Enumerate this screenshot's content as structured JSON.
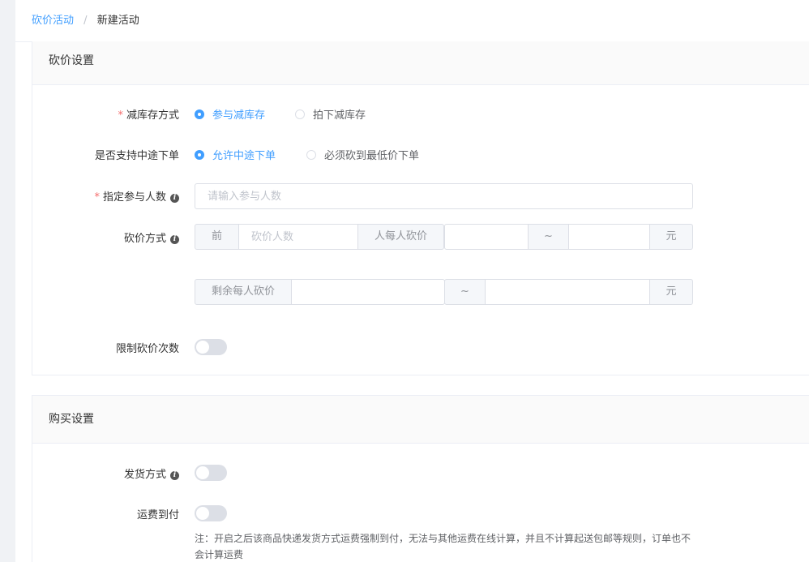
{
  "breadcrumb": {
    "parent": "砍价活动",
    "separator": "/",
    "current": "新建活动"
  },
  "bargain": {
    "title": "砍价设置",
    "stock_mode": {
      "label": "减库存方式",
      "options": [
        "参与减库存",
        "拍下减库存"
      ],
      "selected": 0
    },
    "midway": {
      "label": "是否支持中途下单",
      "options": [
        "允许中途下单",
        "必须砍到最低价下单"
      ],
      "selected": 0
    },
    "participants": {
      "label": "指定参与人数",
      "placeholder": "请输入参与人数"
    },
    "method": {
      "label": "砍价方式",
      "prefix": "前",
      "count_placeholder": "砍价人数",
      "per_person": "人每人砍价",
      "tilde": "~",
      "unit": "元",
      "remaining": "剩余每人砍价"
    },
    "limit": {
      "label": "限制砍价次数",
      "on": false
    }
  },
  "purchase": {
    "title": "购买设置",
    "delivery": {
      "label": "发货方式",
      "on": false
    },
    "freight": {
      "label": "运费到付",
      "on": false
    },
    "note": "注：开启之后该商品快递发货方式运费强制到付，无法与其他运费在线计算，并且不计算起送包邮等规则，订单也不会计算运费"
  },
  "colors": {
    "accent": "#409eff",
    "required": "#f56c6c"
  }
}
